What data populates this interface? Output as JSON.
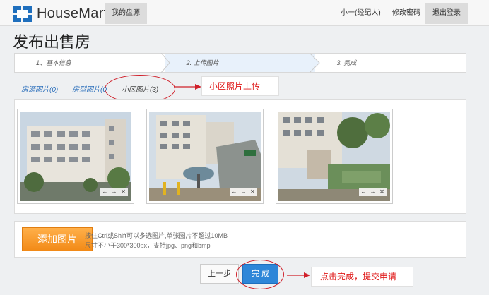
{
  "header": {
    "logo_text": "HouseMart",
    "nav_active": "我的盘源",
    "user": "小一(经纪人)",
    "change_password": "修改密码",
    "logout": "退出登录"
  },
  "page_title": "发布出售房",
  "steps": [
    {
      "label": "1、基本信息",
      "state": "done"
    },
    {
      "label": "2. 上传图片",
      "state": "current"
    },
    {
      "label": "3. 完成",
      "state": "pending"
    }
  ],
  "tabs": [
    {
      "label": "房源图片(0)",
      "active": false
    },
    {
      "label": "房型图片(0",
      "active": false
    },
    {
      "label": "小区图片(3)",
      "active": true
    }
  ],
  "annotations": {
    "tab_callout": "小区照片上传",
    "submit_callout": "点击完成，提交申请"
  },
  "photos": [
    {
      "name": "community-photo-1",
      "controls": [
        "←",
        "→",
        "✕"
      ]
    },
    {
      "name": "community-photo-2",
      "controls": [
        "←",
        "→",
        "✕"
      ]
    },
    {
      "name": "community-photo-3",
      "controls": [
        "←",
        "→",
        "✕"
      ]
    }
  ],
  "upload": {
    "button": "添加图片",
    "hint_line1": "按住Ctrl或Shift可以多选图片,单张图片不超过10MB",
    "hint_line2": "尺寸不小于300*300px，支持jpg、png和bmp"
  },
  "actions": {
    "prev": "上一步",
    "done": "完 成"
  },
  "colors": {
    "primary": "#2e86d8",
    "accent_orange": "#f28a17",
    "annotation_red": "#d0202a",
    "logo_blue": "#1f6fbd"
  }
}
